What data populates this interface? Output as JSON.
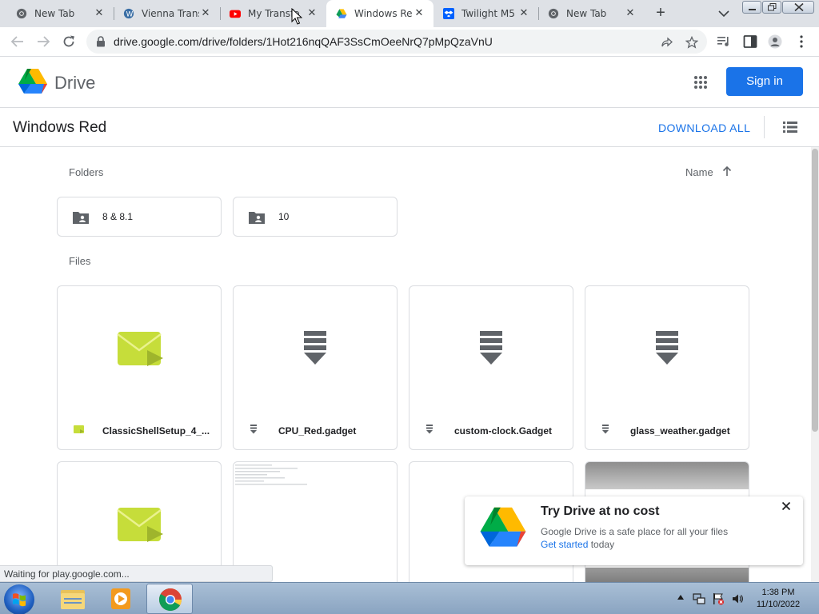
{
  "browser": {
    "tabs": [
      {
        "title": "New Tab",
        "icon": "chrome-icon"
      },
      {
        "title": "Vienna Trans",
        "icon": "wordpress-icon"
      },
      {
        "title": "My Transfo",
        "icon": "youtube-icon"
      },
      {
        "title": "Windows Re",
        "icon": "google-drive-icon"
      },
      {
        "title": "Twilight M5",
        "icon": "dropbox-icon"
      },
      {
        "title": "New Tab",
        "icon": "chrome-icon"
      }
    ],
    "active_tab": 3,
    "url": "drive.google.com/drive/folders/1Hot216nqQAF3SsCmOeeNrQ7pMpQzaVnU"
  },
  "drive": {
    "app_name": "Drive",
    "signin_label": "Sign in",
    "folder_title": "Windows Red",
    "download_all_label": "DOWNLOAD ALL",
    "sort_label": "Name",
    "folders_label": "Folders",
    "files_label": "Files",
    "folders": [
      {
        "name": "8 & 8.1"
      },
      {
        "name": "10"
      }
    ],
    "files": [
      {
        "name": "ClassicShellSetup_4_...",
        "type": "exe"
      },
      {
        "name": "CPU_Red.gadget",
        "type": "gadget"
      },
      {
        "name": "custom-clock.Gadget",
        "type": "gadget"
      },
      {
        "name": "glass_weather.gadget",
        "type": "gadget"
      }
    ]
  },
  "promo": {
    "title": "Try Drive at no cost",
    "desc": "Google Drive is a safe place for all your files",
    "link": "Get started",
    "after_link": " today"
  },
  "status_text": "Waiting for play.google.com...",
  "taskbar": {
    "time": "1:38 PM",
    "date": "11/10/2022"
  },
  "colors": {
    "accent": "#1a73e8",
    "exe_icon": "#c6dd3a",
    "gadget_icon": "#5f6368"
  }
}
